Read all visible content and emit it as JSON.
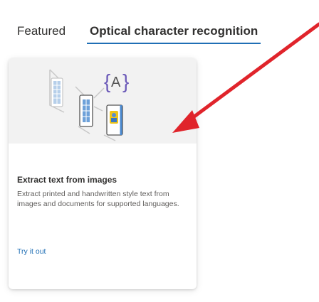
{
  "tabs": [
    {
      "label": "Featured",
      "selected": false
    },
    {
      "label": "Optical character recognition",
      "selected": true
    }
  ],
  "card": {
    "illustration_icon": "ocr-documents-icon",
    "title": "Extract text from images",
    "description": "Extract printed and handwritten style text from images and documents for supported languages.",
    "link_label": "Try it out"
  },
  "annotation": {
    "type": "red-arrow",
    "color": "#e0242b"
  },
  "colors": {
    "accent": "#1f6fb5",
    "card_hero_bg": "#f2f2f2",
    "text_primary": "#323130",
    "text_secondary": "#605e5c"
  }
}
